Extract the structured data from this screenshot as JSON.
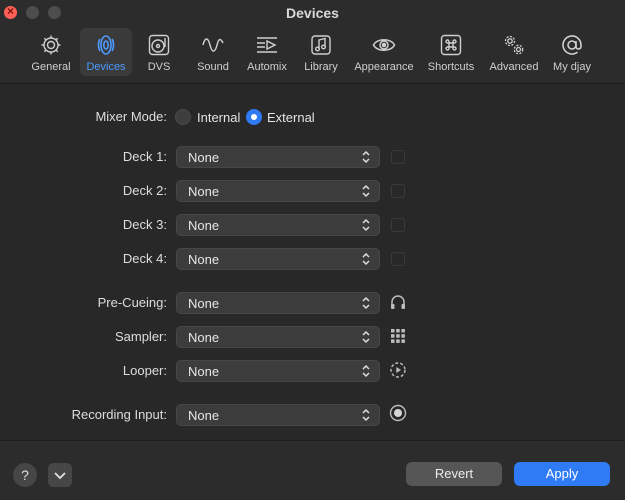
{
  "window": {
    "title": "Devices"
  },
  "toolbar": {
    "items": [
      {
        "label": "General",
        "icon": "gear-icon"
      },
      {
        "label": "Devices",
        "icon": "speaker-icon",
        "active": true
      },
      {
        "label": "DVS",
        "icon": "turntable-icon"
      },
      {
        "label": "Sound",
        "icon": "sine-wave-icon"
      },
      {
        "label": "Automix",
        "icon": "automix-icon"
      },
      {
        "label": "Library",
        "icon": "music-note-icon"
      },
      {
        "label": "Appearance",
        "icon": "eye-icon"
      },
      {
        "label": "Shortcuts",
        "icon": "command-key-icon"
      },
      {
        "label": "Advanced",
        "icon": "gears-icon"
      },
      {
        "label": "My djay",
        "icon": "at-sign-icon"
      }
    ]
  },
  "mixer": {
    "label": "Mixer Mode:",
    "options": [
      "Internal",
      "External"
    ],
    "selected": "External"
  },
  "decks": [
    {
      "label": "Deck 1:",
      "value": "None"
    },
    {
      "label": "Deck 2:",
      "value": "None"
    },
    {
      "label": "Deck 3:",
      "value": "None"
    },
    {
      "label": "Deck 4:",
      "value": "None"
    }
  ],
  "extras": [
    {
      "label": "Pre-Cueing:",
      "value": "None",
      "icon": "headphones-icon"
    },
    {
      "label": "Sampler:",
      "value": "None",
      "icon": "grid-icon"
    },
    {
      "label": "Looper:",
      "value": "None",
      "icon": "looper-icon"
    }
  ],
  "recording": {
    "label": "Recording Input:",
    "value": "None",
    "icon": "record-icon"
  },
  "footer": {
    "help": "?",
    "revert": "Revert",
    "apply": "Apply"
  },
  "colors": {
    "accent": "#2f7bf5",
    "active_tab": "#4e9bff",
    "close": "#fe5f57"
  }
}
